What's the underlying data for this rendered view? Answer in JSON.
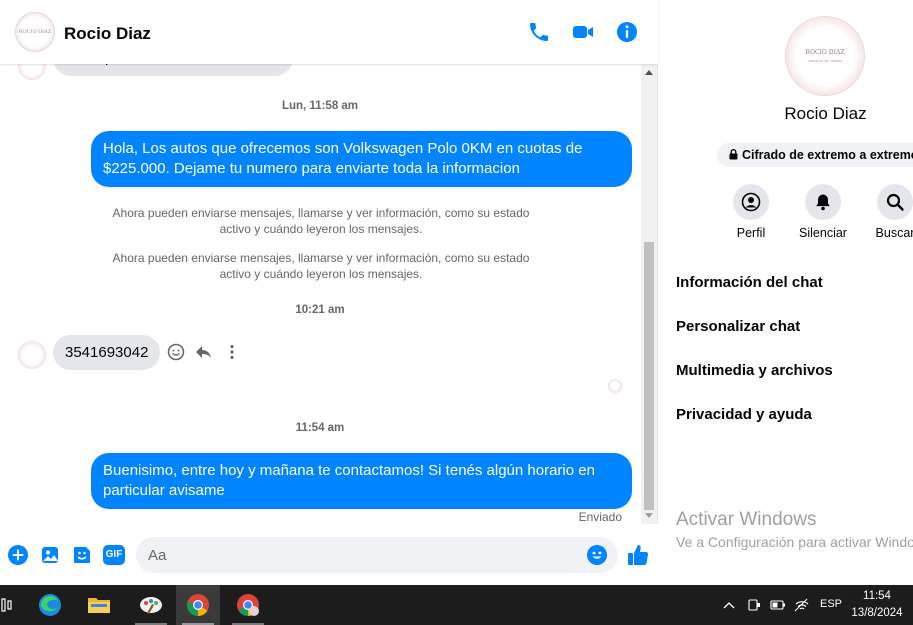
{
  "header": {
    "contact_name": "Rocio Diaz",
    "avatar_text": "ROCIO DIAZ",
    "icons": [
      "phone-icon",
      "video-camera-icon",
      "info-icon"
    ]
  },
  "conversation": {
    "clipped_top_message": "Hola quiero información del auto",
    "timestamps": [
      "Lun, 11:58 am",
      "10:21 am",
      "11:54 am"
    ],
    "outgoing": [
      "Hola, Los autos que ofrecemos son Volkswagen Polo 0KM en cuotas de $225.000. Dejame tu numero para enviarte toda la informacion",
      "Buenisimo, entre hoy y mañana te contactamos! Si tenés algún horario en particular avisame"
    ],
    "system": [
      "Ahora pueden enviarse mensajes, llamarse y ver información, como su estado activo y cuándo leyeron los mensajes.",
      "Ahora pueden enviarse mensajes, llamarse y ver información, como su estado activo y cuándo leyeron los mensajes."
    ],
    "incoming_number": "3541693042",
    "status": "Enviado"
  },
  "composer": {
    "placeholder": "Aa",
    "icons": [
      "plus-icon",
      "photo-icon",
      "sticker-icon",
      "gif-icon",
      "emoji-icon",
      "thumbs-up-icon"
    ],
    "gif_label": "GIF"
  },
  "info_panel": {
    "name": "Rocio Diaz",
    "avatar_line1": "ROCIO DIAZ",
    "avatar_line2": "Asesora de ventas",
    "encryption": "Cifrado de extremo a extremo",
    "actions": [
      {
        "label": "Perfil",
        "icon": "profile-icon"
      },
      {
        "label": "Silenciar",
        "icon": "bell-icon"
      },
      {
        "label": "Buscar",
        "icon": "search-icon"
      }
    ],
    "menu": [
      "Información del chat",
      "Personalizar chat",
      "Multimedia y archivos",
      "Privacidad y ayuda"
    ]
  },
  "watermark": {
    "title": "Activar Windows",
    "subtitle": "Ve a Configuración para activar Windows."
  },
  "taskbar": {
    "apps": [
      "task-view-icon",
      "edge-icon",
      "file-explorer-icon",
      "paint-icon",
      "chrome-icon",
      "chrome-profile-icon"
    ],
    "language": "ESP",
    "time": "11:54",
    "date": "13/8/2024"
  },
  "colors": {
    "messenger_blue": "#0084ff",
    "incoming_bubble": "#e4e6eb",
    "taskbar": "#1c1c1c"
  }
}
